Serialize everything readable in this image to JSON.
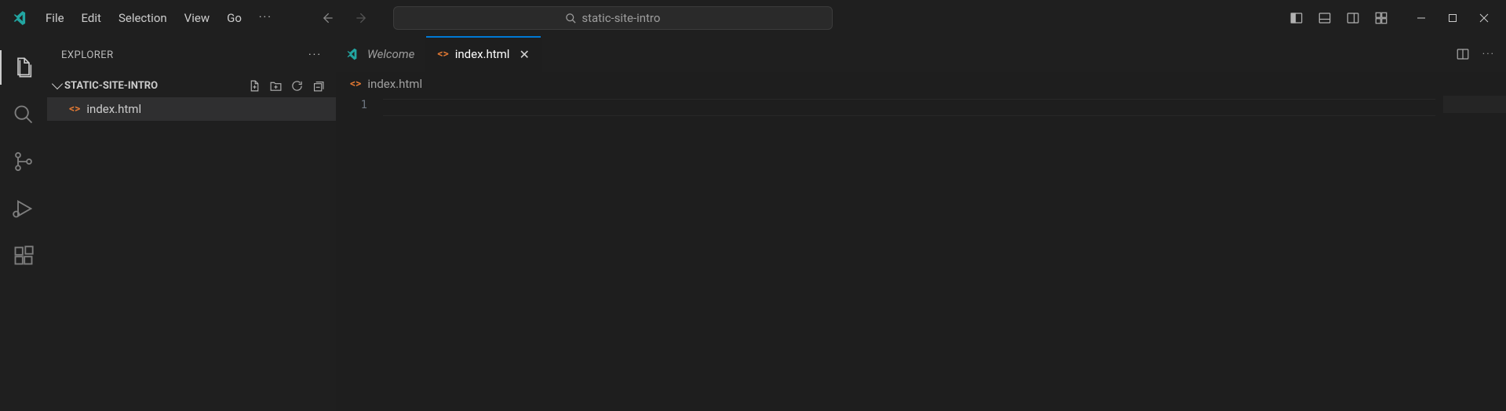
{
  "menu": {
    "items": [
      "File",
      "Edit",
      "Selection",
      "View",
      "Go"
    ]
  },
  "search": {
    "placeholder": "static-site-intro"
  },
  "sidebar": {
    "title": "EXPLORER",
    "folder": "STATIC-SITE-INTRO",
    "files": [
      {
        "name": "index.html"
      }
    ]
  },
  "tabs": [
    {
      "label": "Welcome",
      "type": "welcome",
      "active": false
    },
    {
      "label": "index.html",
      "type": "file",
      "active": true
    }
  ],
  "breadcrumb": {
    "file": "index.html"
  },
  "editor": {
    "line_number": "1"
  }
}
